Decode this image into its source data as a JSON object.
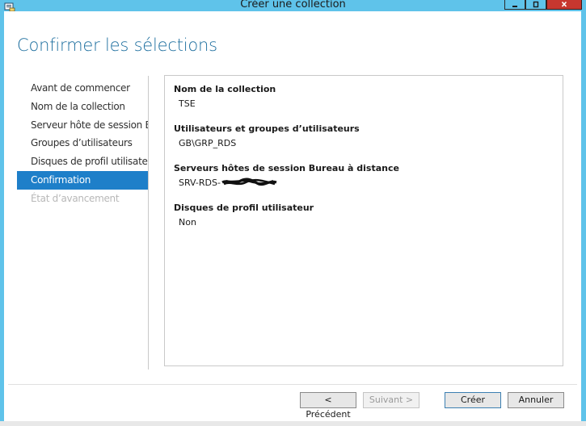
{
  "window": {
    "title": "Créer une collection"
  },
  "page": {
    "title": "Confirmer les sélections"
  },
  "nav": {
    "items": [
      {
        "label": "Avant de commencer",
        "state": "normal"
      },
      {
        "label": "Nom de la collection",
        "state": "normal"
      },
      {
        "label": "Serveur hôte de session B...",
        "state": "normal"
      },
      {
        "label": "Groupes d’utilisateurs",
        "state": "normal"
      },
      {
        "label": "Disques de profil utilisateur",
        "state": "normal"
      },
      {
        "label": "Confirmation",
        "state": "active"
      },
      {
        "label": "État d’avancement",
        "state": "disabled"
      }
    ]
  },
  "confirmation": {
    "collection_name_label": "Nom de la collection",
    "collection_name_value": "TSE",
    "user_groups_label": "Utilisateurs et groupes d’utilisateurs",
    "user_groups_value": "GB\\GRP_RDS",
    "session_hosts_label": "Serveurs hôtes de session Bureau à distance",
    "session_hosts_value": "SRV-RDS-",
    "profile_disks_label": "Disques de profil utilisateur",
    "profile_disks_value": "Non"
  },
  "buttons": {
    "previous": "< Précédent",
    "next": "Suivant >",
    "create": "Créer",
    "cancel": "Annuler"
  },
  "colors": {
    "accent": "#1e7fc9",
    "title_bar": "#5fc3ea",
    "page_title": "#1e6f9f",
    "close_button": "#c7372f"
  }
}
